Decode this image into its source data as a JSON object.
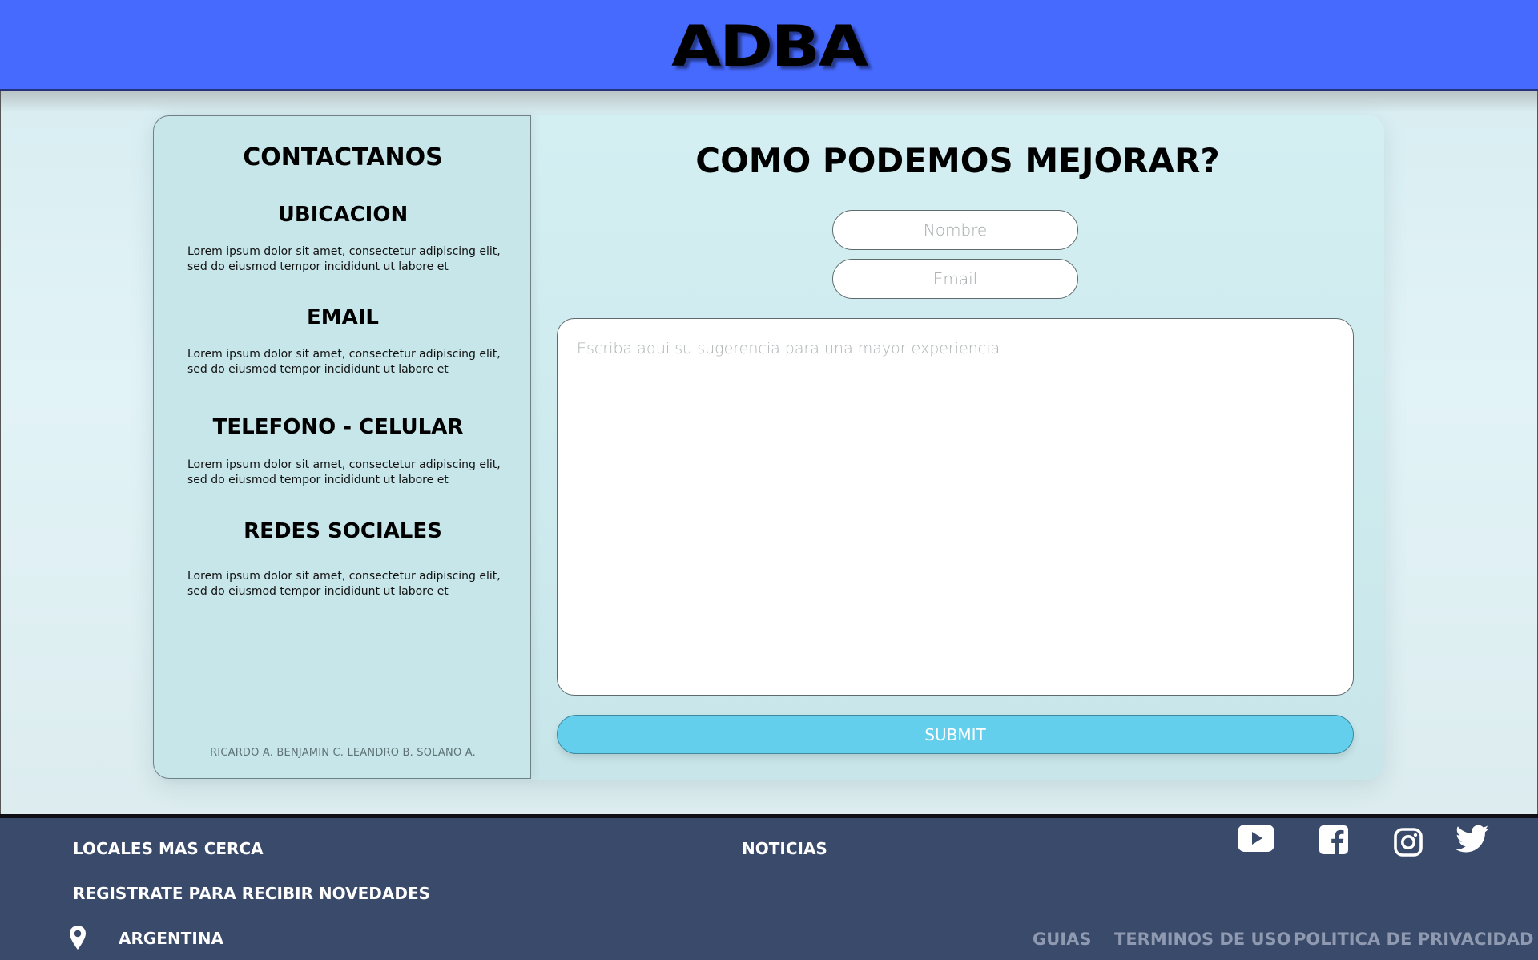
{
  "header": {
    "logo_text": "ADBA"
  },
  "contact": {
    "title": "CONTACTANOS",
    "sections": [
      {
        "heading": "UBICACION",
        "text": "Lorem ipsum dolor sit amet, consectetur adipiscing elit, sed do eiusmod tempor incididunt ut labore et"
      },
      {
        "heading": "EMAIL",
        "text": "Lorem ipsum dolor sit amet, consectetur adipiscing elit, sed do eiusmod tempor incididunt ut labore et"
      },
      {
        "heading": "TELEFONO - CELULAR",
        "text": "Lorem ipsum dolor sit amet, consectetur adipiscing elit, sed do eiusmod tempor incididunt ut labore et"
      },
      {
        "heading": "REDES SOCIALES",
        "text": "Lorem ipsum dolor sit amet, consectetur adipiscing elit, sed do eiusmod tempor incididunt ut labore et"
      }
    ],
    "credits": "RICARDO A. BENJAMIN C. LEANDRO B. SOLANO A."
  },
  "form": {
    "title": "COMO PODEMOS MEJORAR?",
    "name_placeholder": "Nombre",
    "email_placeholder": "Email",
    "message_placeholder": "Escriba aqui su sugerencia para una mayor experiencia",
    "submit_label": "SUBMIT"
  },
  "footer": {
    "locales": "LOCALES MAS CERCA",
    "noticias": "NOTICIAS",
    "registrate": "REGISTRATE PARA RECIBIR NOVEDADES",
    "country": "ARGENTINA",
    "legal": [
      "GUIAS",
      "TERMINOS DE USO",
      "POLITICA DE PRIVACIDAD"
    ],
    "social_icons": [
      "youtube-icon",
      "facebook-icon",
      "instagram-icon",
      "twitter-icon"
    ]
  },
  "colors": {
    "header_bg": "#4669fe",
    "footer_bg": "#3a4a6b",
    "card_bg": "#c7e6ea",
    "submit_bg": "#63cfec"
  }
}
